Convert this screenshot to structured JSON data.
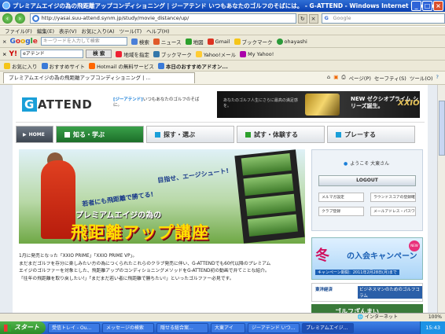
{
  "window": {
    "title": "プレミアムエイジの為の飛距離アップコンディショニング | ジーアテンド いつもあなたのゴルフのそばには。 - G-ATTEND - Windows Internet Explorer"
  },
  "address_bar": {
    "url": "http://yasai.suu-attend.synm.jp/study/movie_distance/up/",
    "search_placeholder": "Google"
  },
  "menu": [
    "ファイル(F)",
    "編集(E)",
    "表示(V)",
    "お気に入り(A)",
    "ツール(T)",
    "ヘルプ(H)"
  ],
  "google_toolbar": {
    "input_placeholder": "キーワードを入力して検索",
    "items": [
      "検索",
      "ニュース",
      "地図",
      "Gmail",
      "ブックマーク",
      "ohayashi"
    ]
  },
  "yahoo_toolbar": {
    "logo": "Y!",
    "input_value": "eアテンド",
    "search_label": "検 索",
    "items": [
      "地域を指定",
      "ブックマーク",
      "Yahoo!メール",
      "My Yahoo!"
    ]
  },
  "favorites_bar": {
    "label": "お気に入り",
    "items": [
      "おすすめサイト",
      "Hotmail の無料サービス",
      "本日のおすすめアドオン..."
    ]
  },
  "tab": {
    "label": "プレミアムエイジの為の飛距離アップコンディショニング | ...",
    "tools": [
      "ページ(P)",
      "セーフティ(S)",
      "ツール(O)"
    ]
  },
  "site": {
    "logo_g": "G",
    "logo_rest": "ATTEND",
    "tagline_brand": "[ジーアテンド]",
    "tagline_rest": "いつもあなたのゴルフのそばに。",
    "banner_text": "あなたのゴルフ人生にさらに最高の満足感を。",
    "banner_new": "NEW ゼクシオプライム シリーズ誕生。",
    "banner_brand": "XXIO",
    "nav": {
      "home": "HOME",
      "items": [
        "知る・学ぶ",
        "探す・選ぶ",
        "試す・体験する",
        "プレーする"
      ]
    },
    "hero": {
      "slogan1": "若者にも飛距離で勝てる!",
      "slogan2": "目指せ、エージシュート!",
      "sub": "プレミアムエイジの為の",
      "main": "飛距離アップ講座"
    },
    "intro": [
      "1月に発売となった「XXIO PRIME」「XXIO PRIME VP」。",
      "まだまだゴルフを存分に楽しみたい方の為につくられたこれらのクラブ発売に伴い、G-ATTENDでも60代以降のプレミアム",
      "エイジのゴルファーを対象とした、飛距離アップのコンディショニングメソッドをG-ATTEND初の動画で弁てことな紹介。",
      "「往年の飛距離を取り戻したい!」「まだまだ若い者に飛距離で勝ちたい!」といったゴルファー必見です。"
    ],
    "sidebar": {
      "welcome": "ようこそ 大東さん",
      "logout": "LOGOUT",
      "buttons": [
        "メルマガ設定",
        "ラウンドスコアの登録確認",
        "クラブ登録",
        "メールアドレス・パスワード変更"
      ],
      "campaign_big": "冬",
      "campaign_mid": "の入会キャンペーン",
      "campaign_date": "キャンペーン期間：2011年2月28日(月)まで",
      "campaign_new": "NEW",
      "mag_left": "東洋経済",
      "mag_right": "ビジネスマンのためのゴルフコラム",
      "golf_banner": "ゴルフざんまい"
    }
  },
  "status_bar": {
    "zone": "インターネット",
    "zoom": "100%"
  },
  "taskbar": {
    "start": "スタート",
    "tasks": [
      "受信トレイ - Ou...",
      "メッセージの検索",
      "隠せる総合案...",
      "大東アイ",
      "ジーアテンド いつ...",
      "プレミアムエイジ..."
    ],
    "time": "15:43"
  },
  "colors": {
    "accent_green": "#2c8a26",
    "brand_blue": "#1a9fd8",
    "title_blue": "#0a3fb0"
  }
}
